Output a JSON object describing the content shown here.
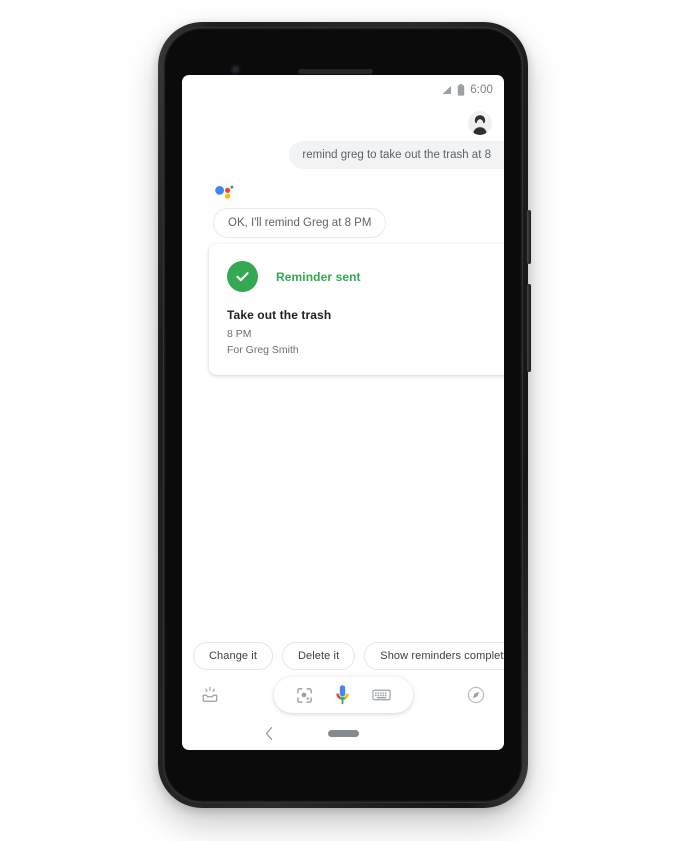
{
  "device": {
    "name": "pixel-phone",
    "frame_color": "#1d1d1f"
  },
  "status_bar": {
    "time": "6:00",
    "signal_icon": "signal-triangle-icon",
    "battery_icon": "battery-full-icon"
  },
  "header": {
    "avatar_icon": "account-avatar-icon"
  },
  "conversation": {
    "user_message": "remind greg to take out the trash at 8",
    "assistant_logo_icon": "google-assistant-dots-icon",
    "assistant_message": "OK, I'll remind Greg at 8 PM"
  },
  "reminder_card": {
    "status_icon": "check-circle-icon",
    "status_label": "Reminder sent",
    "title": "Take out the trash",
    "time": "8 PM",
    "recipient": "For Greg Smith",
    "status_color": "#34a853"
  },
  "suggestions": {
    "chips": [
      {
        "label": "Change it"
      },
      {
        "label": "Delete it"
      },
      {
        "label": "Show reminders completed b"
      }
    ]
  },
  "bottom_bar": {
    "snapshot_icon": "snapshot-inbox-icon",
    "lens_icon": "google-lens-icon",
    "mic_icon": "google-mic-icon",
    "keyboard_icon": "keyboard-icon",
    "explore_icon": "explore-compass-icon"
  },
  "nav_bar": {
    "back_icon": "back-chevron-icon",
    "home_icon": "home-pill-icon"
  },
  "colors": {
    "google_blue": "#4285f4",
    "google_red": "#ea4335",
    "google_yellow": "#fbbc05",
    "google_green": "#34a853",
    "bubble_gray": "#f1f3f4",
    "text_gray": "#5f6368"
  }
}
